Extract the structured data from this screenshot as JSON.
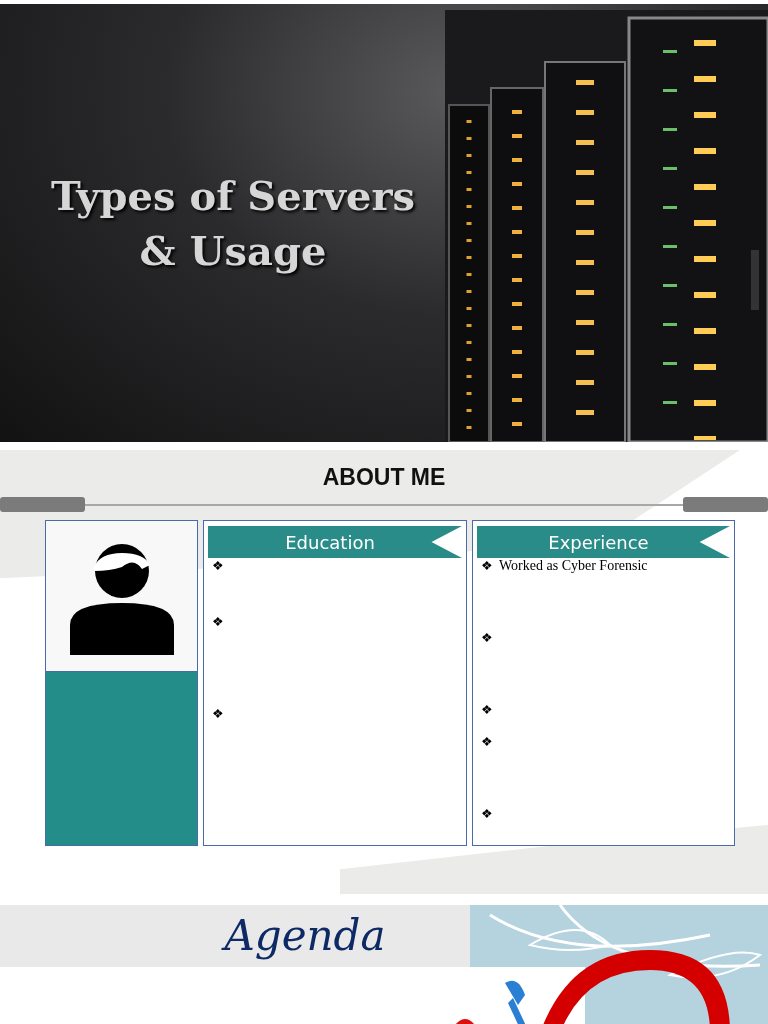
{
  "slides": [
    {
      "kind": "title",
      "title_lines": [
        "Types of Servers",
        "& Usage"
      ],
      "picture": {
        "kind": "picture"
      }
    },
    {
      "kind": "about",
      "title": "ABOUT ME",
      "profile": {
        "kind": "avatar"
      },
      "cards": [
        {
          "heading": "Education",
          "bullets": [
            {
              "marker": "❖"
            },
            {
              "marker": "❖"
            },
            {
              "marker": "❖"
            }
          ]
        },
        {
          "heading": "Experience",
          "bullets": [
            {
              "marker": "❖",
              "text": "Worked as Cyber Forensic"
            },
            {
              "marker": "❖"
            },
            {
              "marker": "❖"
            },
            {
              "marker": "❖"
            },
            {
              "marker": "❖"
            }
          ]
        }
      ]
    },
    {
      "kind": "agenda",
      "title": "Agenda",
      "picture": {
        "kind": "picture"
      }
    }
  ]
}
